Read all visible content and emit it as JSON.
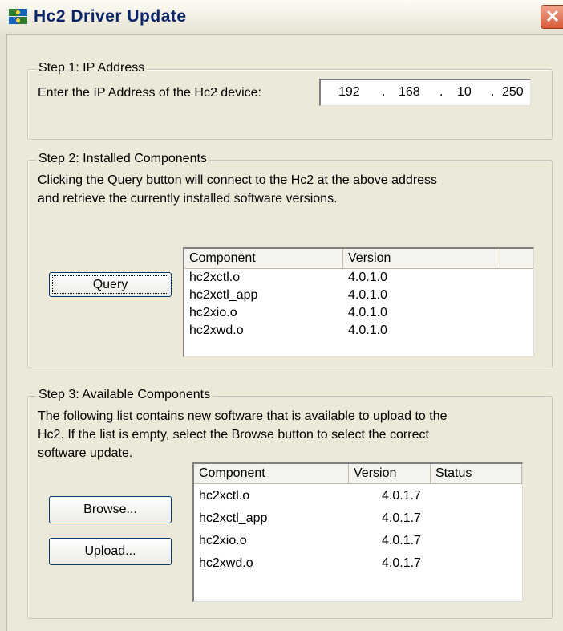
{
  "window": {
    "title": "Hc2 Driver Update",
    "close_glyph": "✕",
    "icon": "puzzle-icon"
  },
  "step1": {
    "legend": "Step 1: IP Address",
    "prompt": "Enter the IP Address of the Hc2 device:",
    "ip": {
      "octet1": "192",
      "octet2": "168",
      "octet3": "10",
      "octet4": "250",
      "separator": "."
    }
  },
  "step2": {
    "legend": "Step 2: Installed Components",
    "description_line1": "Clicking the Query button will connect to the Hc2 at the above address",
    "description_line2": "and retrieve the currently installed software versions.",
    "query_button": "Query",
    "columns": {
      "component": "Component",
      "version": "Version"
    },
    "rows": [
      {
        "component": "hc2xctl.o",
        "version": "4.0.1.0"
      },
      {
        "component": "hc2xctl_app",
        "version": "4.0.1.0"
      },
      {
        "component": "hc2xio.o",
        "version": "4.0.1.0"
      },
      {
        "component": "hc2xwd.o",
        "version": "4.0.1.0"
      }
    ]
  },
  "step3": {
    "legend": "Step 3: Available Components",
    "description_line1": "The following list contains new software that is available to upload to the",
    "description_line2": "Hc2.  If the list is empty, select the Browse button to select the correct",
    "description_line3": "software update.",
    "browse_button": "Browse...",
    "upload_button": "Upload...",
    "columns": {
      "component": "Component",
      "version": "Version",
      "status": "Status"
    },
    "rows": [
      {
        "component": "hc2xctl.o",
        "version": "4.0.1.7",
        "status": ""
      },
      {
        "component": "hc2xctl_app",
        "version": "4.0.1.7",
        "status": ""
      },
      {
        "component": "hc2xio.o",
        "version": "4.0.1.7",
        "status": ""
      },
      {
        "component": "hc2xwd.o",
        "version": "4.0.1.7",
        "status": ""
      }
    ]
  },
  "colors": {
    "dialog_bg": "#ece9d8",
    "title_text": "#0a246a",
    "close_button": "#d65a3a",
    "button_border": "#003c74"
  }
}
